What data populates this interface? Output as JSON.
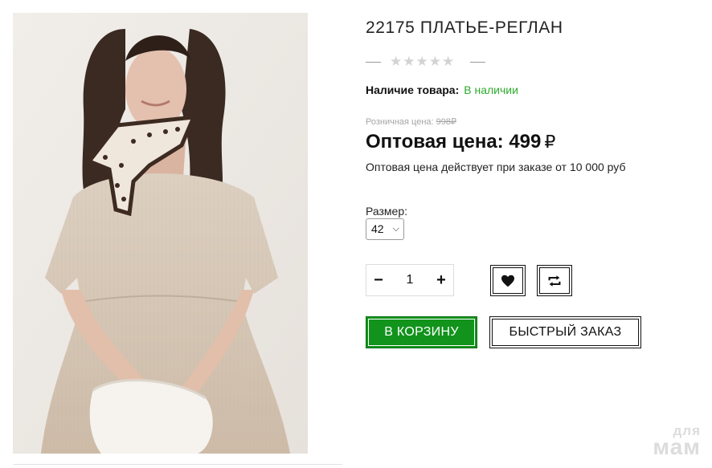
{
  "product": {
    "title": "22175 ПЛАТЬЕ-РЕГЛАН",
    "rating_stars": "★★★★★",
    "availability_label": "Наличие товара:",
    "availability_value": "В наличии",
    "retail_label": "Розничная цена:",
    "retail_price": "998₽",
    "wholesale_label": "Оптовая цена:",
    "wholesale_price": "499",
    "currency": "₽",
    "wholesale_note": "Оптовая цена действует при заказе от 10 000 руб",
    "size_label": "Размер:",
    "size_value": "42",
    "quantity": "1",
    "qty_minus": "−",
    "qty_plus": "+",
    "cart_button": "В КОРЗИНУ",
    "quick_order_button": "БЫСТРЫЙ ЗАКАЗ",
    "photo_alt": "product photo: woman in beige dress with printed neck scarf holding white bag"
  },
  "icons": {
    "favorite": "heart-icon",
    "compare": "compare-icon",
    "size_dropdown": "chevron-down-icon"
  },
  "watermark": {
    "line1": "для",
    "line2": "мам"
  },
  "colors": {
    "accent_green": "#12931c",
    "in_stock_green": "#2eaa2e",
    "muted_gray": "#a5a5a5"
  }
}
